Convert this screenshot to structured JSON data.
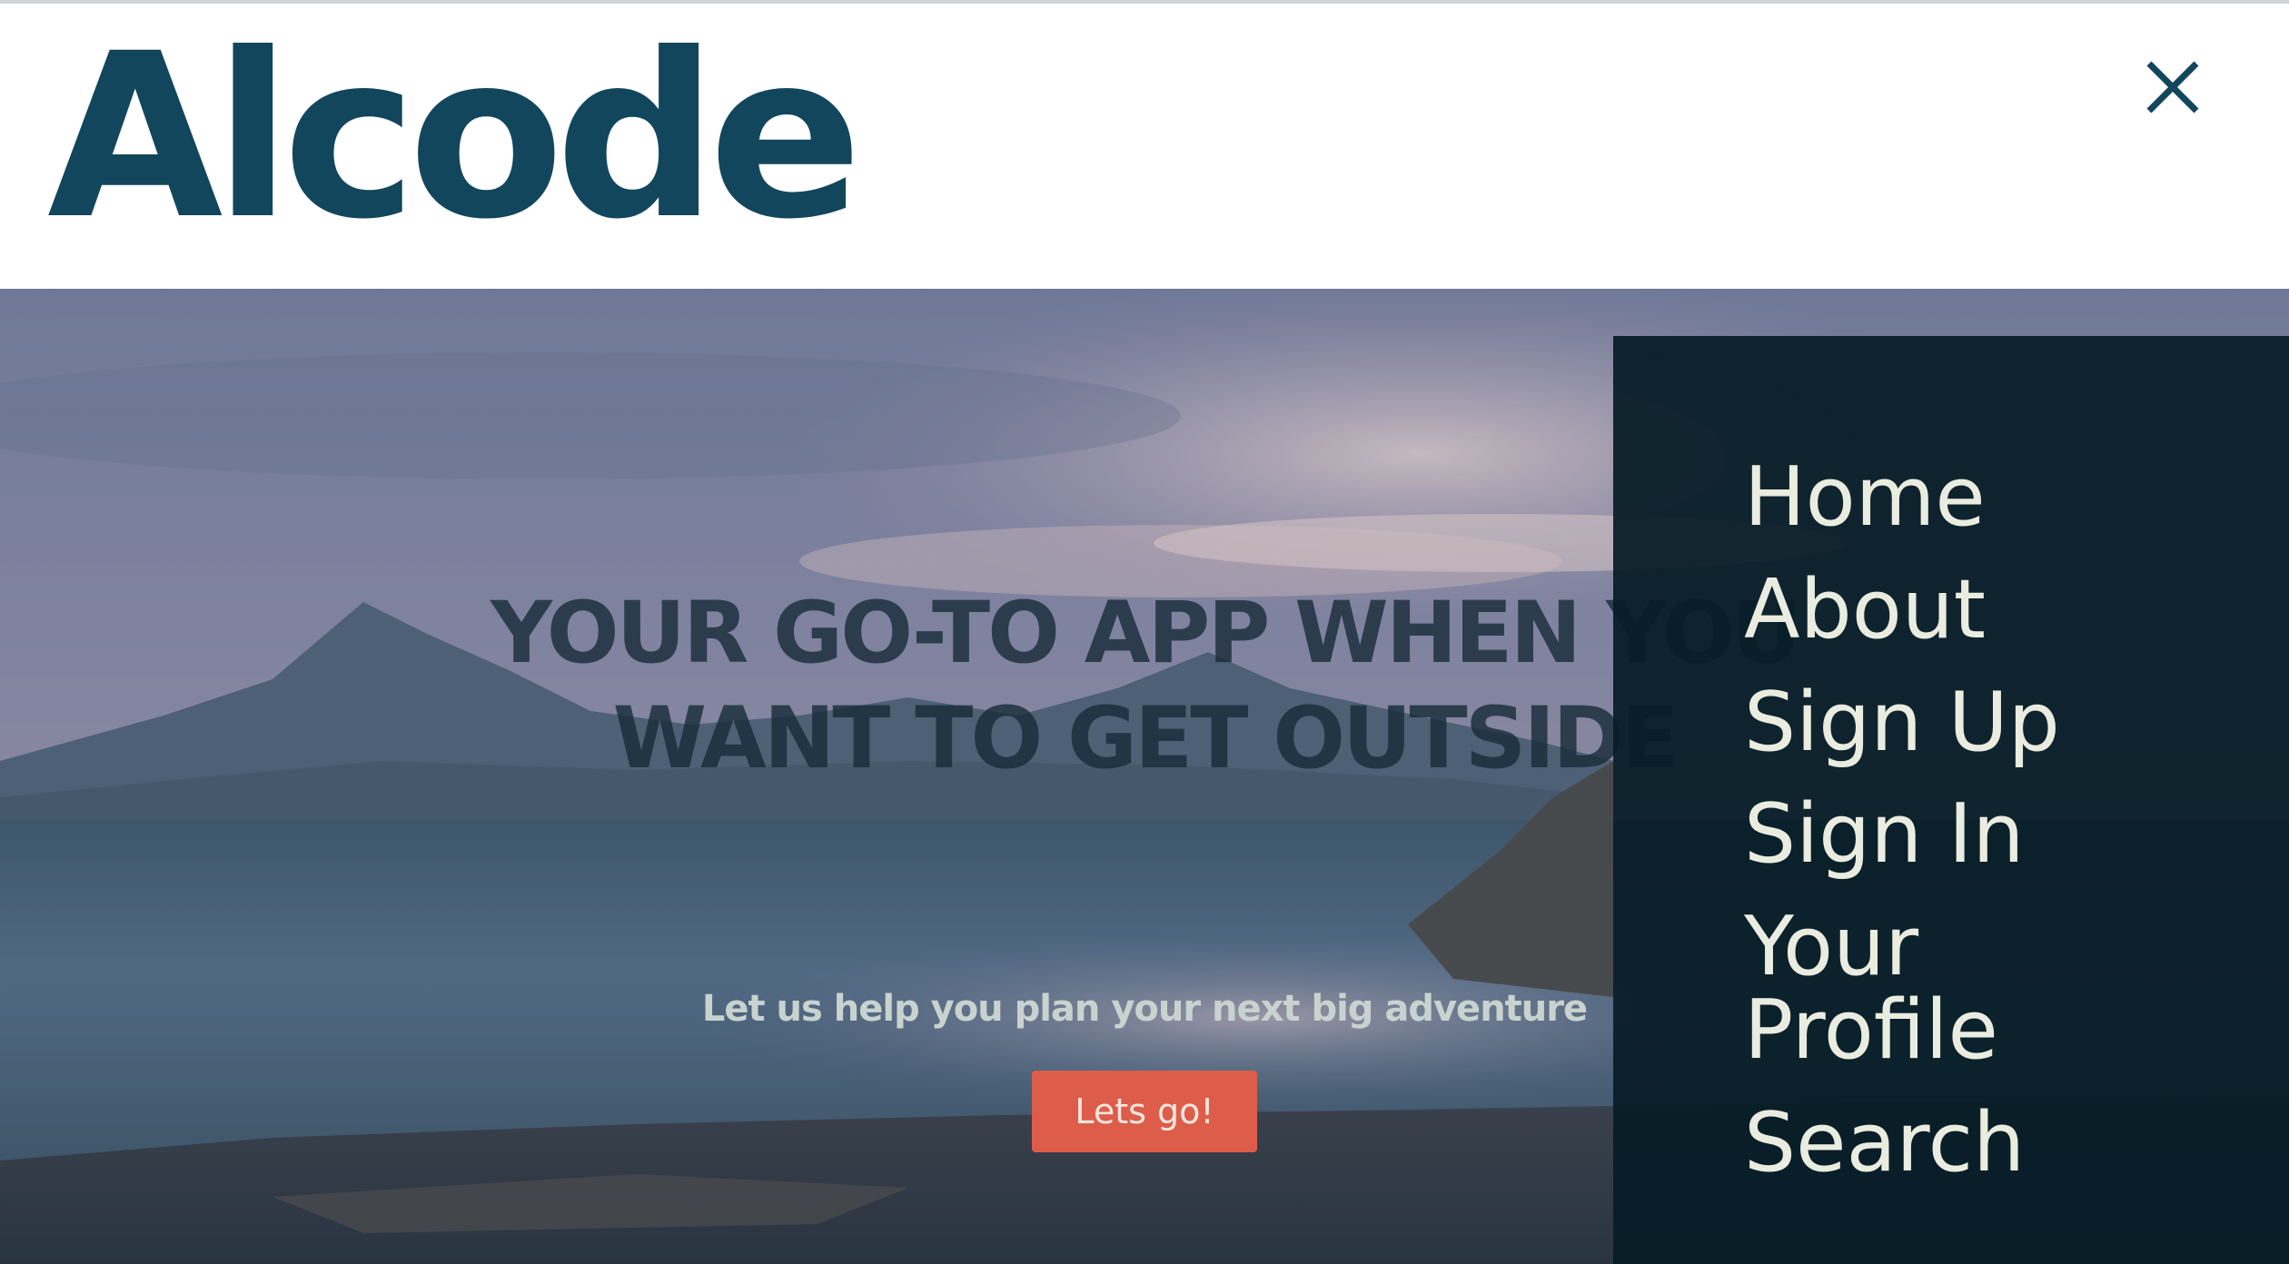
{
  "header": {
    "brand": "Alcode",
    "close_icon": "close-icon"
  },
  "hero": {
    "headline_line1": "YOUR GO-TO APP WHEN YOU",
    "headline_line2": "WANT TO GET OUTSIDE",
    "tagline": "Let us help you plan your next big adventure",
    "cta_label": "Lets go!"
  },
  "nav": {
    "items": [
      {
        "label": "Home"
      },
      {
        "label": "About"
      },
      {
        "label": "Sign Up"
      },
      {
        "label": "Sign In"
      },
      {
        "label": "Your"
      },
      {
        "label": "Profile"
      },
      {
        "label": "Search"
      }
    ]
  },
  "colors": {
    "brand": "#12465d",
    "nav_panel": "#061c26",
    "nav_text": "#e9ecdf",
    "cta": "#dd5d4a",
    "headline": "#162b38",
    "tagline": "#c8d3cf"
  }
}
